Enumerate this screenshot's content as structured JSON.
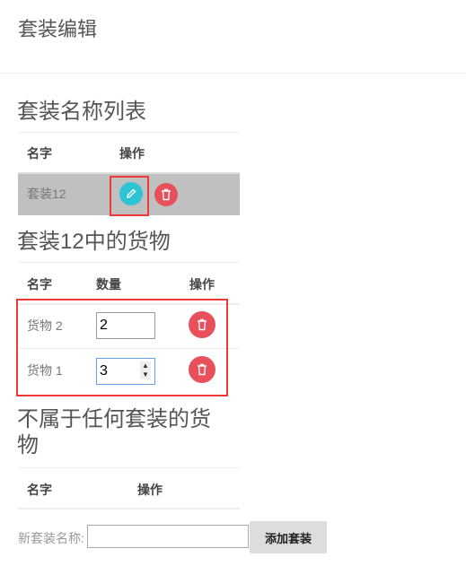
{
  "page_title": "套装编辑",
  "suites": {
    "heading": "套装名称列表",
    "columns": [
      "名字",
      "操作"
    ],
    "rows": [
      {
        "name": "套装12"
      }
    ]
  },
  "goods_in_suite": {
    "heading": "套装12中的货物",
    "columns": [
      "名字",
      "数量",
      "操作"
    ],
    "rows": [
      {
        "name": "货物 2",
        "quantity": "2"
      },
      {
        "name": "货物 1",
        "quantity": "3"
      }
    ]
  },
  "unassigned": {
    "heading_line1": "不属于任何套装的货",
    "heading_line2": "物",
    "columns": [
      "名字",
      "操作"
    ]
  },
  "form": {
    "label": "新套装名称:",
    "input_value": "",
    "button": "添加套装"
  },
  "colors": {
    "edit": "#2ec4d4",
    "delete": "#e8505b",
    "highlight_row": "#c0c0c0",
    "annotation": "#f03a3a"
  }
}
